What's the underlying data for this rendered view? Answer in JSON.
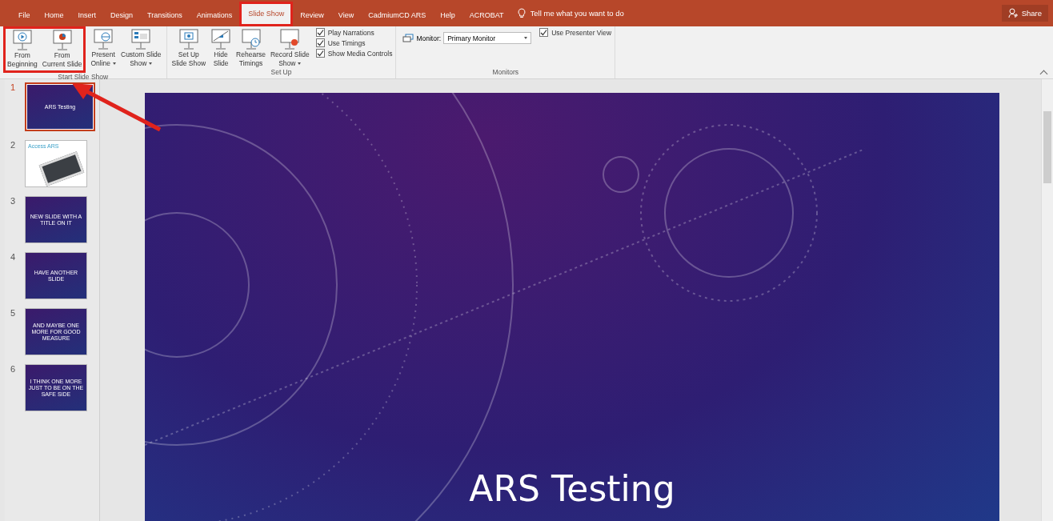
{
  "tabs": [
    {
      "label": "File",
      "selected": false
    },
    {
      "label": "Home",
      "selected": false
    },
    {
      "label": "Insert",
      "selected": false
    },
    {
      "label": "Design",
      "selected": false
    },
    {
      "label": "Transitions",
      "selected": false
    },
    {
      "label": "Animations",
      "selected": false
    },
    {
      "label": "Slide Show",
      "selected": true,
      "highlighted": true
    },
    {
      "label": "Review",
      "selected": false
    },
    {
      "label": "View",
      "selected": false
    },
    {
      "label": "CadmiumCD ARS",
      "selected": false
    },
    {
      "label": "Help",
      "selected": false
    },
    {
      "label": "ACROBAT",
      "selected": false
    }
  ],
  "tell_me": {
    "placeholder": "Tell me what you want to do"
  },
  "share": {
    "label": "Share"
  },
  "ribbon": {
    "groups": [
      {
        "label": "Start Slide Show",
        "buttons": [
          {
            "kind": "play",
            "lines": [
              "From",
              "Beginning"
            ],
            "dropdown": false,
            "highlighted": true
          },
          {
            "kind": "current",
            "lines": [
              "From",
              "Current Slide"
            ],
            "dropdown": false,
            "highlighted": true
          },
          {
            "kind": "online",
            "lines": [
              "Present",
              "Online"
            ],
            "dropdown": true
          },
          {
            "kind": "custom",
            "lines": [
              "Custom Slide",
              "Show"
            ],
            "dropdown": true
          }
        ]
      },
      {
        "label": "Set Up",
        "buttons": [
          {
            "kind": "setup",
            "lines": [
              "Set Up",
              "Slide Show"
            ],
            "dropdown": false
          },
          {
            "kind": "hide",
            "lines": [
              "Hide",
              "Slide"
            ],
            "dropdown": false
          },
          {
            "kind": "rehearse",
            "lines": [
              "Rehearse",
              "Timings"
            ],
            "dropdown": false
          },
          {
            "kind": "record",
            "lines": [
              "Record Slide",
              "Show"
            ],
            "dropdown": true
          }
        ],
        "checks": [
          {
            "label": "Play Narrations",
            "checked": true
          },
          {
            "label": "Use Timings",
            "checked": true
          },
          {
            "label": "Show Media Controls",
            "checked": true
          }
        ]
      },
      {
        "label": "Monitors",
        "monitor": {
          "label": "Monitor:",
          "value": "Primary Monitor"
        },
        "checks": [
          {
            "label": "Use Presenter View",
            "checked": true
          }
        ]
      }
    ]
  },
  "thumbnails": [
    {
      "number": "1",
      "kind": "title",
      "title": "ARS Testing",
      "selected": true
    },
    {
      "number": "2",
      "kind": "photo",
      "title": "Access ARS",
      "selected": false
    },
    {
      "number": "3",
      "kind": "title",
      "title": "NEW SLIDE WITH A TITLE ON IT",
      "selected": false
    },
    {
      "number": "4",
      "kind": "title",
      "title": "HAVE ANOTHER SLIDE",
      "selected": false
    },
    {
      "number": "5",
      "kind": "title",
      "title": "AND MAYBE ONE MORE FOR GOOD MEASURE",
      "selected": false
    },
    {
      "number": "6",
      "kind": "title",
      "title": "I THINK ONE MORE JUST TO BE ON THE SAFE SIDE",
      "selected": false
    }
  ],
  "slide": {
    "title": "ARS Testing"
  }
}
